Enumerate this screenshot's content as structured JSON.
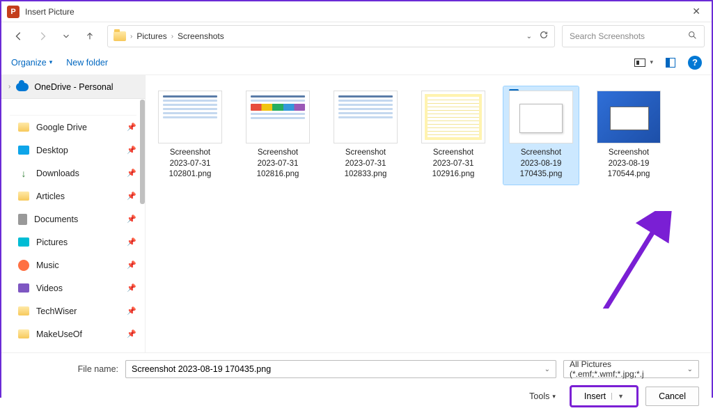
{
  "window": {
    "title": "Insert Picture",
    "app_badge": "P"
  },
  "nav": {
    "breadcrumb": [
      "Pictures",
      "Screenshots"
    ],
    "search_placeholder": "Search Screenshots"
  },
  "toolbar": {
    "organize": "Organize",
    "new_folder": "New folder"
  },
  "sidebar": {
    "top": "OneDrive - Personal",
    "items": [
      {
        "label": "Google Drive",
        "icon": "folder"
      },
      {
        "label": "Desktop",
        "icon": "desktop"
      },
      {
        "label": "Downloads",
        "icon": "download"
      },
      {
        "label": "Articles",
        "icon": "folder"
      },
      {
        "label": "Documents",
        "icon": "document"
      },
      {
        "label": "Pictures",
        "icon": "pictures"
      },
      {
        "label": "Music",
        "icon": "music"
      },
      {
        "label": "Videos",
        "icon": "video"
      },
      {
        "label": "TechWiser",
        "icon": "folder"
      },
      {
        "label": "MakeUseOf",
        "icon": "folder"
      }
    ]
  },
  "files": [
    {
      "name": "Screenshot 2023-07-31 102801.png",
      "selected": false,
      "thumb": 1
    },
    {
      "name": "Screenshot 2023-07-31 102816.png",
      "selected": false,
      "thumb": 2
    },
    {
      "name": "Screenshot 2023-07-31 102833.png",
      "selected": false,
      "thumb": 3
    },
    {
      "name": "Screenshot 2023-07-31 102916.png",
      "selected": false,
      "thumb": 4
    },
    {
      "name": "Screenshot 2023-08-19 170435.png",
      "selected": true,
      "thumb": 5
    },
    {
      "name": "Screenshot 2023-08-19 170544.png",
      "selected": false,
      "thumb": 6
    }
  ],
  "footer": {
    "filename_label": "File name:",
    "filename_value": "Screenshot 2023-08-19 170435.png",
    "filetype": "All Pictures (*.emf;*.wmf;*.jpg;*.j",
    "tools": "Tools",
    "insert": "Insert",
    "cancel": "Cancel"
  }
}
